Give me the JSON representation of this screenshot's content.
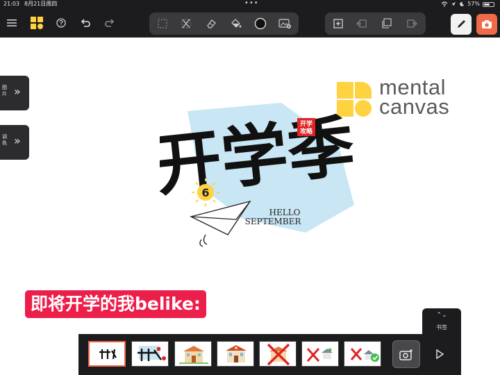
{
  "status_bar": {
    "time": "21:03",
    "date": "8月21日周四",
    "dots": "•••",
    "battery": "57%"
  },
  "toolbar": {
    "left_icons": [
      "menu-icon",
      "app-grid-icon",
      "help-icon",
      "undo-icon",
      "redo-icon"
    ],
    "tools_group": [
      "select-rect-icon",
      "cut-icon",
      "eraser-icon",
      "fill-bucket-icon",
      "color-circle-icon",
      "image-insert-icon"
    ],
    "view_group": [
      "add-frame-icon",
      "frame-left-icon",
      "copy-frame-icon",
      "frame-right-icon"
    ],
    "right_icons": [
      "pen-icon",
      "camera-icon"
    ]
  },
  "side_panels": [
    {
      "label": "图片",
      "chevron": "»"
    },
    {
      "label": "调色",
      "chevron": "»"
    }
  ],
  "brand": {
    "line1": "mental",
    "line2": "canvas",
    "color": "#ffd23f"
  },
  "artwork": {
    "title": "开学季",
    "seal_top": "开学",
    "seal_bottom": "攻略",
    "number": "6",
    "hello": "HELLO",
    "september": "SEPTEMBER"
  },
  "caption": {
    "text": "即将开学的我belike:",
    "color": "#ec1e4a"
  },
  "bookmark": {
    "arrows": "⌃⌄",
    "label": "书签"
  },
  "filmstrip": {
    "thumbnails": [
      {
        "name": "title-sketch",
        "selected": true
      },
      {
        "name": "title-color",
        "selected": false
      },
      {
        "name": "school-building",
        "selected": false
      },
      {
        "name": "school-building-2",
        "selected": false
      },
      {
        "name": "crossed-building",
        "selected": false
      },
      {
        "name": "crossed-house",
        "selected": false
      },
      {
        "name": "crossed-house-check",
        "selected": false
      }
    ],
    "accent": "#f06a4a"
  }
}
